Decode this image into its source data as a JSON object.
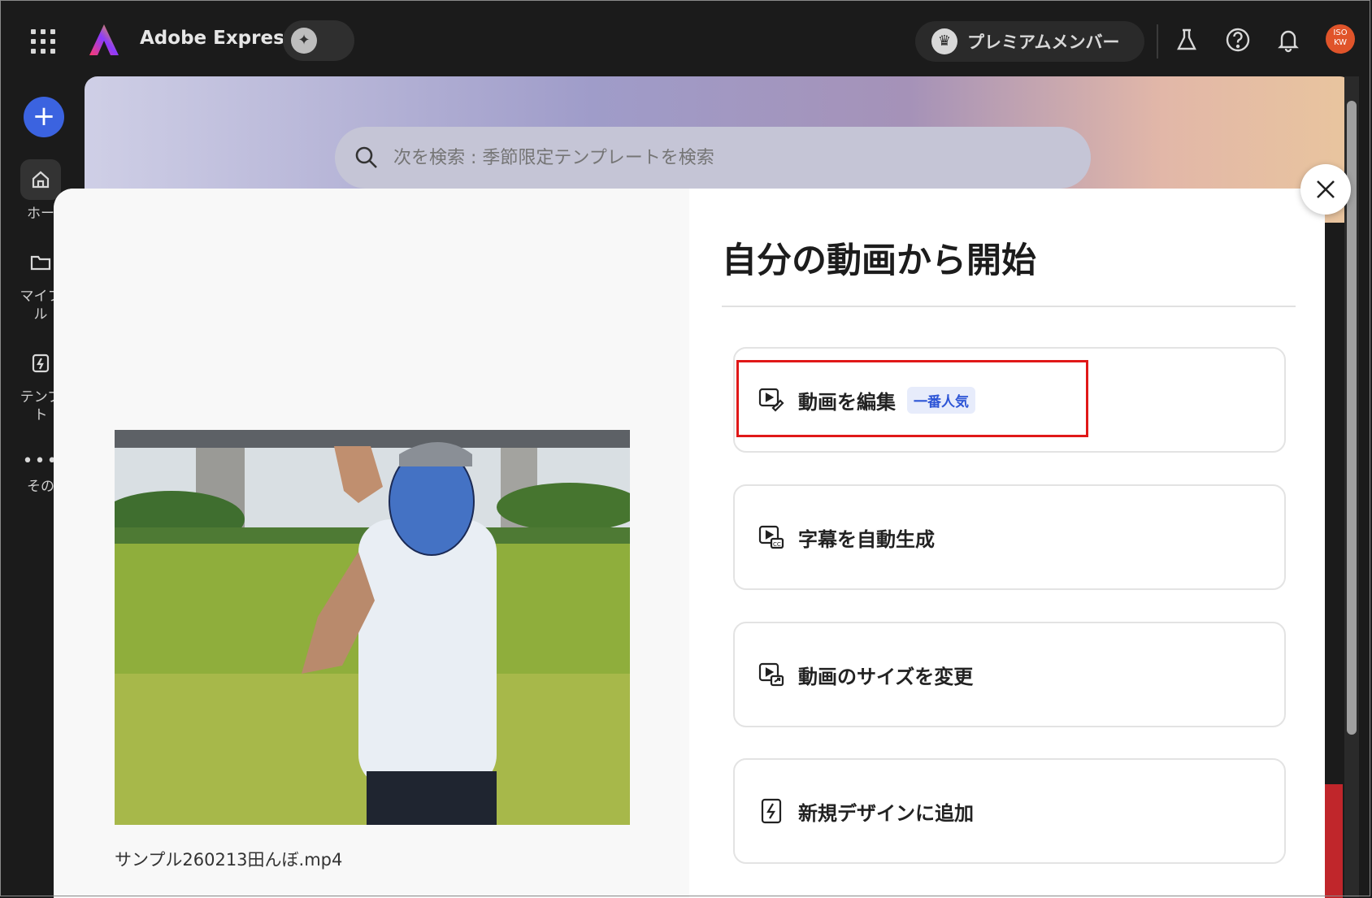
{
  "app": {
    "title": "Adobe Express"
  },
  "header": {
    "premium_label": "プレミアムメンバー",
    "avatar_text_1": "ISO",
    "avatar_text_2": "KW"
  },
  "sidebar": {
    "create_symbol": "+",
    "items": [
      {
        "icon": "home-icon",
        "label_1": "ホー",
        "label_2": ""
      },
      {
        "icon": "folder-icon",
        "label_1": "マイフ",
        "label_2": "ル"
      },
      {
        "icon": "template-icon",
        "label_1": "テンプ",
        "label_2": "ト"
      },
      {
        "icon": "more-icon",
        "label_1": "その",
        "label_2": ""
      }
    ]
  },
  "search": {
    "placeholder": "次を検索 : 季節限定テンプレートを検索"
  },
  "modal": {
    "title": "自分の動画から開始",
    "filename": "サンプル260213田んぼ.mp4",
    "options": [
      {
        "icon": "video-edit-icon",
        "label": "動画を編集",
        "badge": "一番人気"
      },
      {
        "icon": "caption-icon",
        "label": "字幕を自動生成"
      },
      {
        "icon": "resize-video-icon",
        "label": "動画のサイズを変更"
      },
      {
        "icon": "add-design-icon",
        "label": "新規デザインに追加"
      }
    ]
  },
  "colors": {
    "accent_blue": "#3b63e0",
    "highlight_red": "#e01818",
    "badge_text": "#2d55d6"
  }
}
